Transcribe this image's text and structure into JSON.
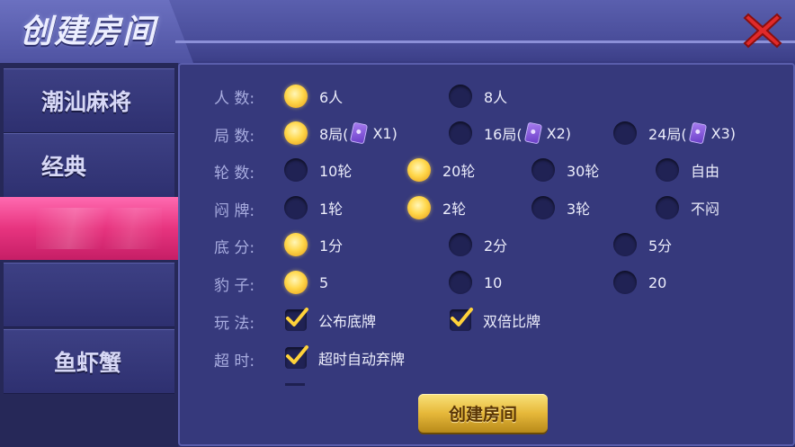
{
  "header": {
    "title": "创建房间",
    "close_icon": "close-x-icon",
    "close_color": "#e02a2a"
  },
  "sidebar": {
    "items": [
      {
        "label": "潮汕麻将"
      },
      {
        "label": "经典"
      },
      {
        "label": ""
      },
      {
        "label": ""
      },
      {
        "label": "鱼虾蟹"
      }
    ],
    "active_index": 2,
    "active_color": "#e7347f"
  },
  "settings": {
    "players": {
      "label": "人  数:",
      "options": [
        {
          "text": "6人",
          "selected": true
        },
        {
          "text": "8人",
          "selected": false
        }
      ]
    },
    "rounds": {
      "label": "局  数:",
      "options": [
        {
          "text": "8局(",
          "cost": "X1)",
          "selected": true
        },
        {
          "text": "16局(",
          "cost": "X2)",
          "selected": false
        },
        {
          "text": "24局(",
          "cost": "X3)",
          "selected": false
        }
      ]
    },
    "turns": {
      "label": "轮  数:",
      "options": [
        {
          "text": "10轮",
          "selected": false
        },
        {
          "text": "20轮",
          "selected": true
        },
        {
          "text": "30轮",
          "selected": false
        },
        {
          "text": "自由",
          "selected": false
        }
      ]
    },
    "blind": {
      "label": "闷  牌:",
      "options": [
        {
          "text": "1轮",
          "selected": false
        },
        {
          "text": "2轮",
          "selected": true
        },
        {
          "text": "3轮",
          "selected": false
        },
        {
          "text": "不闷",
          "selected": false
        }
      ]
    },
    "base": {
      "label": "底  分:",
      "options": [
        {
          "text": "1分",
          "selected": true
        },
        {
          "text": "2分",
          "selected": false
        },
        {
          "text": "5分",
          "selected": false
        }
      ]
    },
    "leopard": {
      "label": "豹  子:",
      "options": [
        {
          "text": "5",
          "selected": true
        },
        {
          "text": "10",
          "selected": false
        },
        {
          "text": "20",
          "selected": false
        }
      ]
    },
    "rules": {
      "label": "玩  法:",
      "options": [
        {
          "text": "公布底牌",
          "checked": true
        },
        {
          "text": "双倍比牌",
          "checked": true
        }
      ]
    },
    "timeout": {
      "label": "超  时:",
      "options": [
        {
          "text": "超时自动弃牌",
          "checked": true
        }
      ]
    }
  },
  "create_button": {
    "label": "创建房间"
  },
  "colors": {
    "accent_gold": "#ffd74b",
    "panel_bg": "#36397c",
    "checkmark": "#ffd23a"
  }
}
